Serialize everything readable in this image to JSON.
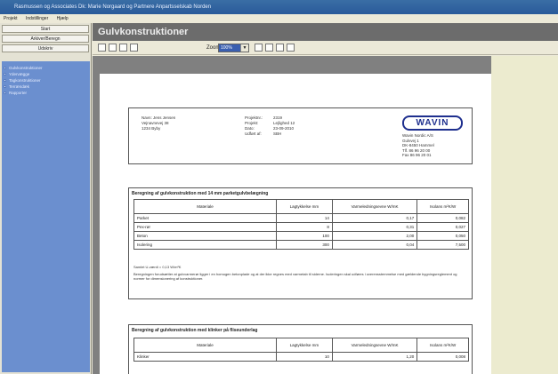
{
  "window": {
    "title": "Rasmussen og Associates Dk: Marie Norgaard og Partnere Anpartsselskab Norden"
  },
  "menu": [
    "Projekt",
    "Indstillinger",
    "Hjælp"
  ],
  "sidebar": {
    "buttons": [
      "Start",
      "Arkiver/Beregn",
      "Udskriv"
    ],
    "nav_items": [
      "Gulvkonstruktioner",
      "Ydervægge",
      "Tagkonstruktioner",
      "Terrændæk",
      "Rapporter"
    ]
  },
  "header": {
    "title": "Gulvkonstruktioner"
  },
  "toolbar": {
    "zoom_label": "Zoom",
    "zoom_value": "100%"
  },
  "document": {
    "info": {
      "col1": [
        "Navn: Jens Jensen",
        "",
        "Vejnavnevej 38",
        "1234 Byby"
      ],
      "col2": [
        "Projektnr.:",
        "Projekt:",
        "Dato:",
        "Udført af:"
      ],
      "col3": [
        "2319",
        "Lejlighed 12",
        "23-09-2010",
        "SBH"
      ]
    },
    "company": {
      "logo": "WAVIN",
      "address": [
        "Wavin Nordic A/S",
        "Gulvvej 1",
        "DK-8450 Hammel",
        "Tlf. 86 96 20 00",
        "Fax 86 96 20 01"
      ]
    },
    "table1": {
      "title": "Beregning af gulvkonstruktion med 14 mm parketgulvbelægning",
      "headers": [
        "Materiale",
        "Lagtykkelse mm",
        "Varmeledningsevne W/mK",
        "Isolans m²K/W"
      ],
      "rows": [
        [
          "Parket",
          "14",
          "0,17",
          "0,082"
        ],
        [
          "Pex-rør",
          "8",
          "0,31",
          "0,027"
        ],
        [
          "Beton",
          "100",
          "2,00",
          "0,050"
        ],
        [
          "Isolering",
          "300",
          "0,04",
          "7,500"
        ]
      ],
      "summary": "Samlet U-værdi = 0,13 W/m²K",
      "note": "Beregningen forudsætter at gulvvarmerør ligger i en homogen betonplade og at der ikke regnes med varmetab til siderne. Isoleringen skal udføres i overensstemmelse med gældende bygningsreglement og normer for dimensionering af konstruktioner."
    },
    "table2": {
      "title": "Beregning af gulvkonstruktion med klinker på fliseunderlag",
      "headers": [
        "Materiale",
        "Lagtykkelse mm",
        "Varmeledningsevne W/mK",
        "Isolans m²K/W"
      ],
      "rows": [
        [
          "Klinker",
          "10",
          "1,20",
          "0,008"
        ]
      ]
    }
  }
}
